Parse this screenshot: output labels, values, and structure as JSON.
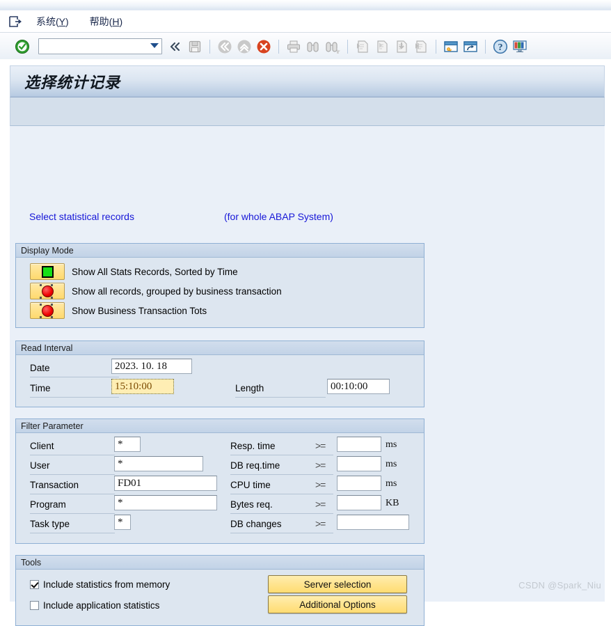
{
  "menubar": {
    "system_icon": "system-menu-icon",
    "items": [
      {
        "label": "系统(Y)",
        "text": "系统(",
        "accel": "Y",
        "tail": ")"
      },
      {
        "label": "帮助(H)",
        "text": "帮助(",
        "accel": "H",
        "tail": ")"
      }
    ]
  },
  "toolbar": {
    "enter_icon": "green-check-icon",
    "command_value": "",
    "command_placeholder": "",
    "dropdown_icon": "chevron-down-icon",
    "icons": [
      "collapse-left-icon",
      "save-icon",
      "back-icon",
      "exit-up-icon",
      "cancel-icon",
      "print-icon",
      "find-icon",
      "find-next-icon",
      "first-page-icon",
      "previous-page-icon",
      "next-page-icon",
      "last-page-icon",
      "create-session-icon",
      "create-shortcut-icon",
      "help-icon",
      "customize-layout-icon"
    ]
  },
  "window": {
    "title": "选择统计记录"
  },
  "links": {
    "select_records": "Select statistical records",
    "scope": "(for whole ABAP System)"
  },
  "display_mode": {
    "title": "Display Mode",
    "options": [
      {
        "label": "Show All Stats Records, Sorted by Time",
        "state": "green",
        "icon": "green-square-icon"
      },
      {
        "label": "Show all records, grouped by business transaction",
        "state": "red",
        "icon": "red-circle-icon"
      },
      {
        "label": "Show Business Transaction Tots",
        "state": "red",
        "icon": "red-circle-icon"
      }
    ]
  },
  "read_interval": {
    "title": "Read Interval",
    "date_label": "Date",
    "date_value": "2023. 10. 18",
    "time_label": "Time",
    "time_value": "15:10:00",
    "length_label": "Length",
    "length_value": "00:10:00"
  },
  "filter_parameter": {
    "title": "Filter Parameter",
    "left_fields": [
      {
        "label": "Client",
        "value": "*"
      },
      {
        "label": "User",
        "value": "*"
      },
      {
        "label": "Transaction",
        "value": "FD01"
      },
      {
        "label": "Program",
        "value": "*"
      },
      {
        "label": "Task type",
        "value": "*"
      }
    ],
    "right_fields": [
      {
        "label": "Resp. time",
        "op": ">=",
        "value": "",
        "unit": "ms"
      },
      {
        "label": "DB req.time",
        "op": ">=",
        "value": "",
        "unit": "ms"
      },
      {
        "label": "CPU time",
        "op": ">=",
        "value": "",
        "unit": "ms"
      },
      {
        "label": "Bytes req.",
        "op": ">=",
        "value": "",
        "unit": "KB"
      },
      {
        "label": "DB changes",
        "op": ">=",
        "value": "",
        "unit": ""
      }
    ]
  },
  "tools": {
    "title": "Tools",
    "checkboxes": [
      {
        "label": "Include statistics from memory",
        "checked": true
      },
      {
        "label": "Include application statistics",
        "checked": false
      }
    ],
    "buttons": [
      {
        "label": "Server selection"
      },
      {
        "label": "Additional Options"
      }
    ]
  },
  "watermark": "CSDN @Spark_Niu",
  "colors": {
    "link": "#1616d8",
    "panel_bg": "#dde6f0",
    "page_bg": "#eaf0f8",
    "button_yellow": "#ffe48f",
    "focus_yellow": "#ffeeb4",
    "status_green": "#17e017",
    "status_red": "#ee0000"
  }
}
